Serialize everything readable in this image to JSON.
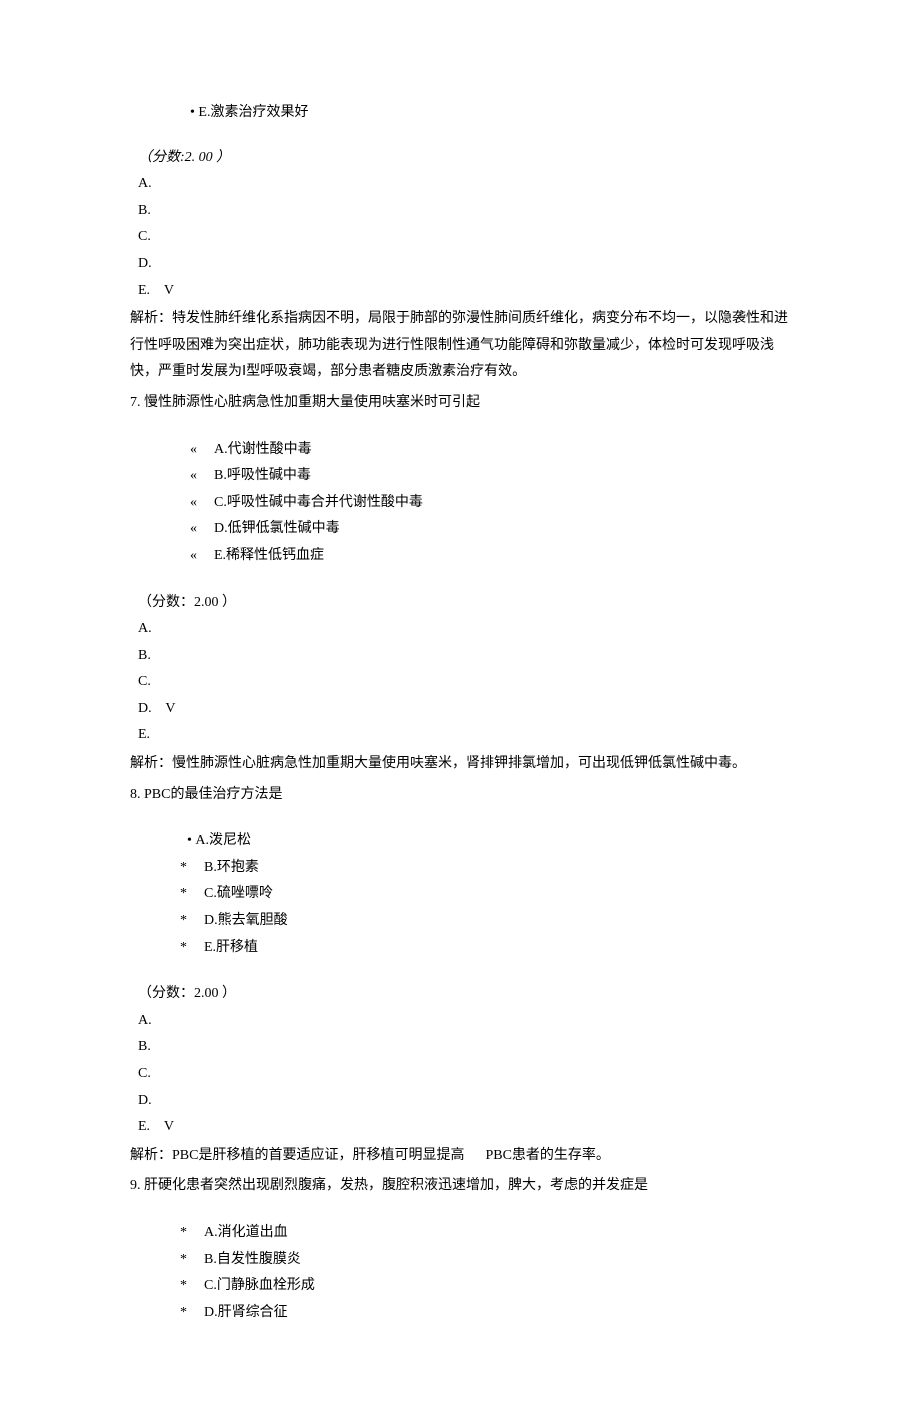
{
  "q6": {
    "optE": "E.激素治疗效果好",
    "score": "（分数:2. 00 ）",
    "A": "A.",
    "B": "B.",
    "C": "C.",
    "D": "D.",
    "E": "E.",
    "check": "V",
    "explain": "解析：特发性肺纤维化系指病因不明，局限于肺部的弥漫性肺间质纤维化，病变分布不均一，以隐袭性和进行性呼吸困难为突出症状，肺功能表现为进行性限制性通气功能障碍和弥散量减少，体检时可发现呼吸浅快，严重时发展为Ⅰ型呼吸衰竭，部分患者糖皮质激素治疗有效。"
  },
  "q7": {
    "stem": "7.  慢性肺源性心脏病急性加重期大量使用呋塞米时可引起",
    "optA": "A.代谢性酸中毒",
    "optB": "B.呼吸性碱中毒",
    "optC": "C.呼吸性碱中毒合并代谢性酸中毒",
    "optD": "D.低钾低氯性碱中毒",
    "optE": "E.稀释性低钙血症",
    "score": "（分数：2.00 ）",
    "A": "A.",
    "B": "B.",
    "C": "C.",
    "D": "D.",
    "E": "E.",
    "check": "V",
    "explain": "解析：慢性肺源性心脏病急性加重期大量使用呋塞米，肾排钾排氯增加，可出现低钾低氯性碱中毒。"
  },
  "q8": {
    "stem": "8.  PBC的最佳治疗方法是",
    "optA": "A.泼尼松",
    "optB": "B.环抱素",
    "optC": "C.硫唑嘌呤",
    "optD": "D.熊去氧胆酸",
    "optE": "E.肝移植",
    "score": "（分数：2.00 ）",
    "A": "A.",
    "B": "B.",
    "C": "C.",
    "D": "D.",
    "E": "E.",
    "check": "V",
    "explainPart1": "解析：PBC是肝移植的首要适应证，肝移植可明显提高",
    "explainPart2": "PBC患者的生存率。"
  },
  "q9": {
    "stem": "9.  肝硬化患者突然出现剧烈腹痛，发热，腹腔积液迅速增加，脾大，考虑的并发症是",
    "optA": "A.消化道出血",
    "optB": "B.自发性腹膜炎",
    "optC": "C.门静脉血栓形成",
    "optD": "D.肝肾综合征"
  },
  "marks": {
    "dot": "•",
    "dquote": "«",
    "star": "*"
  }
}
